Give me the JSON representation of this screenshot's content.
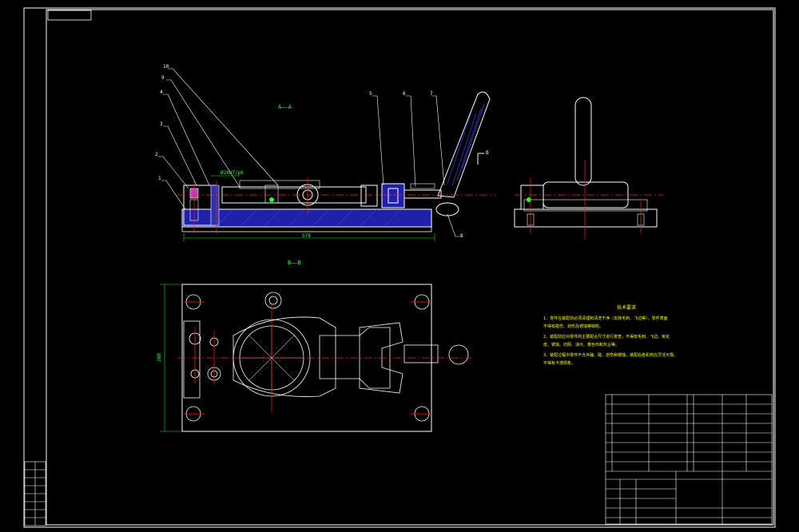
{
  "drawing": {
    "section_labels": {
      "aa": "A——A",
      "bb": "B——B"
    },
    "part_numbers": [
      "10",
      "9",
      "4",
      "3",
      "2",
      "1",
      "5",
      "6",
      "7",
      "8"
    ],
    "fit_note": "Ø28H7/p6",
    "dim_length": "578",
    "dim_height": "260",
    "arrow_b": "B"
  },
  "tech_requirements": {
    "title": "技术要求",
    "lines": [
      "1、零件在装配前必须清理和清洗干净（去除毛刺、飞边等），零件表面",
      "不得有碰伤、划伤及锈蚀等缺陷。",
      "2、装配前应对零件的主要配合尺寸进行复查，不得有毛刺、飞边、氧化",
      "皮、锈蚀、切屑、油污、着色剂和灰尘等。",
      "3、装配过程中零件不允许磕、碰、划伤和锈蚀，装配后各机构应灵活可靠。",
      "不得有卡滞现象。"
    ]
  },
  "colors": {
    "outline": "#ffffff",
    "center": "#ff2020",
    "hatch": "#3b3bff",
    "dim": "#22dd22",
    "text": "#ffff00"
  }
}
